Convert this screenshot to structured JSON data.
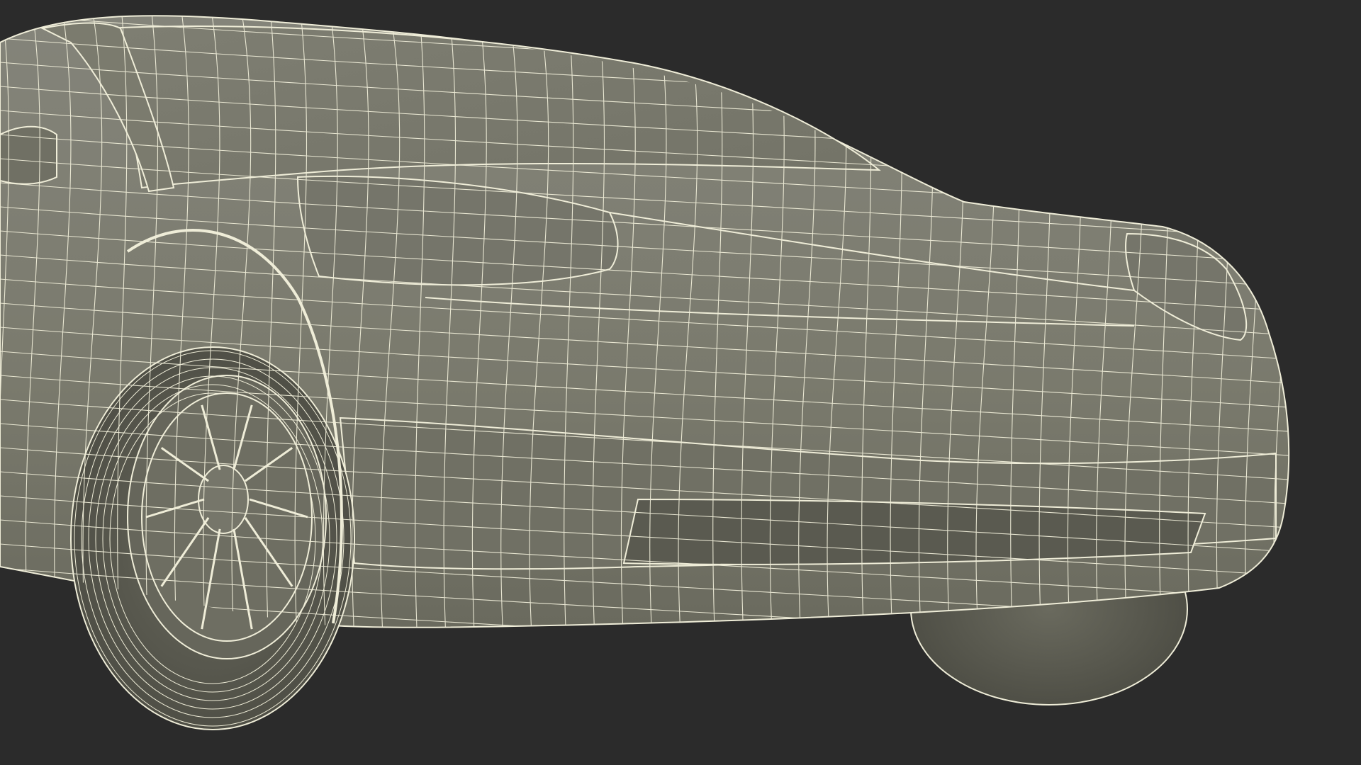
{
  "scene": {
    "subject": "car-front-wireframe",
    "colors": {
      "background": "#2b2b2b",
      "body_fill": "#7d7d6f",
      "body_shadow": "#5e5e53",
      "dark_fill": "#4a4a41",
      "wire": "#efedd8"
    }
  }
}
